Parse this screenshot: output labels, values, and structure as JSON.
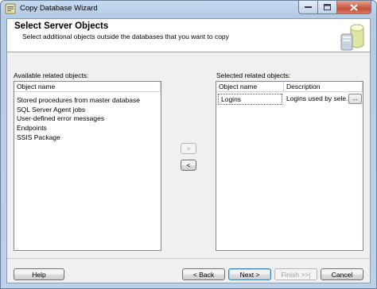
{
  "window": {
    "title": "Copy Database Wizard",
    "icon": "database-wizard-icon"
  },
  "header": {
    "title": "Select Server Objects",
    "subtitle": "Select additional objects outside the databases that you want to copy",
    "graphic": "database-graphic"
  },
  "available": {
    "label": "Available related objects:",
    "column_header": "Object name",
    "items": [
      "Stored procedures from master database",
      "SQL Server Agent jobs",
      "User-defined error messages",
      "Endpoints",
      "SSIS Package"
    ]
  },
  "transfer": {
    "add_label": ">",
    "remove_label": "<"
  },
  "selected": {
    "label": "Selected related objects:",
    "columns": [
      "Object name",
      "Description"
    ],
    "rows": [
      {
        "name": "Logins",
        "description": "Logins used by sele...",
        "button": "..."
      }
    ]
  },
  "buttons": {
    "help": "Help",
    "back": "< Back",
    "next": "Next >",
    "finish": "Finish >>|",
    "cancel": "Cancel"
  }
}
